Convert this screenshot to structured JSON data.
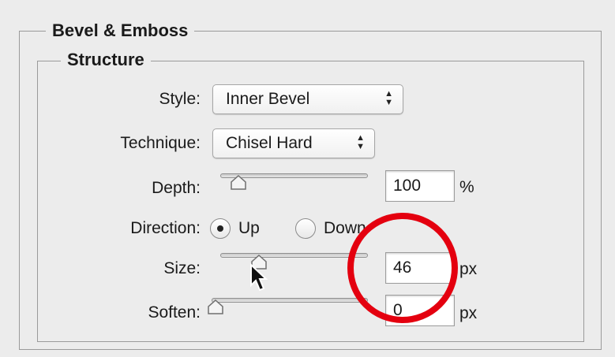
{
  "panel": {
    "group_title": "Bevel & Emboss",
    "section_title": "Structure"
  },
  "style": {
    "label": "Style:",
    "value": "Inner Bevel"
  },
  "technique": {
    "label": "Technique:",
    "value": "Chisel Hard"
  },
  "depth": {
    "label": "Depth:",
    "value": "100",
    "unit": "%",
    "slider_fraction": 0.1
  },
  "direction": {
    "label": "Direction:",
    "options": [
      "Up",
      "Down"
    ],
    "selected": "Up"
  },
  "size": {
    "label": "Size:",
    "value": "46",
    "unit": "px",
    "slider_fraction": 0.25
  },
  "soften": {
    "label": "Soften:",
    "value": "0",
    "unit": "px",
    "slider_fraction": 0.0
  },
  "annotation": {
    "color": "#e4000f",
    "shape": "circle"
  },
  "icons": [
    "updown-arrows-icon",
    "slider-thumb-icon",
    "mouse-pointer-icon"
  ]
}
